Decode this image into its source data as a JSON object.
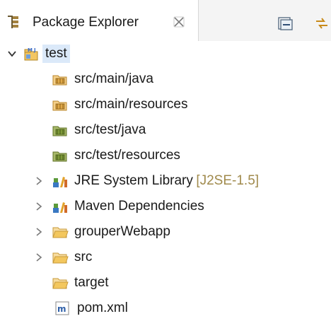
{
  "view": {
    "title": "Package Explorer",
    "icons": {
      "view_icon": "package-explorer-icon",
      "close": "close-icon",
      "collapse_all": "collapse-all-icon",
      "link_editor": "link-with-editor-icon"
    }
  },
  "tree": {
    "project": {
      "label": "test",
      "icon": "maven-java-project-icon",
      "expanded": true,
      "selected": true
    },
    "items": [
      {
        "label": "src/main/java",
        "icon": "source-folder-icon",
        "expandable": false
      },
      {
        "label": "src/main/resources",
        "icon": "source-folder-icon",
        "expandable": false
      },
      {
        "label": "src/test/java",
        "icon": "test-source-folder-icon",
        "expandable": false
      },
      {
        "label": "src/test/resources",
        "icon": "test-source-folder-icon",
        "expandable": false
      },
      {
        "label": "JRE System Library",
        "decoration": "[J2SE-1.5]",
        "icon": "library-icon",
        "expandable": true
      },
      {
        "label": "Maven Dependencies",
        "icon": "library-icon",
        "expandable": true
      },
      {
        "label": "grouperWebapp",
        "icon": "folder-icon",
        "expandable": true
      },
      {
        "label": "src",
        "icon": "folder-icon",
        "expandable": true
      },
      {
        "label": "target",
        "icon": "folder-icon",
        "expandable": false
      },
      {
        "label": "pom.xml",
        "icon": "maven-pom-file-icon",
        "expandable": false
      }
    ]
  },
  "colors": {
    "selection": "#dbe9f9",
    "decoration_text": "#a08a4c",
    "folder": "#e8b85a",
    "library_books": "#3a78c2"
  }
}
